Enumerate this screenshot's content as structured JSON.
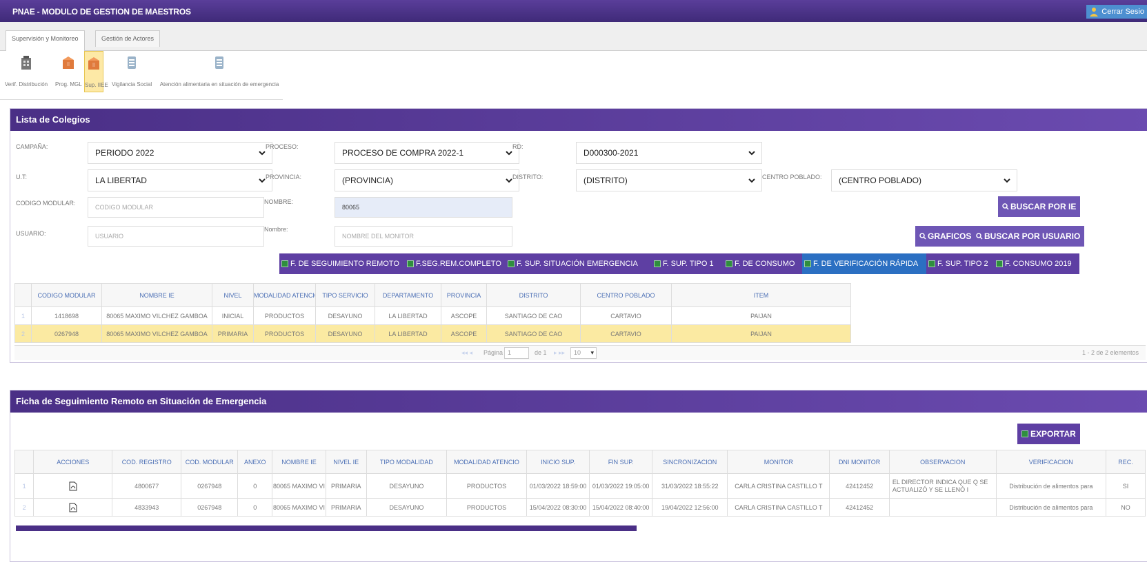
{
  "app": {
    "title": "PNAE - MODULO DE GESTION DE MAESTROS",
    "logout_label": "Cerrar Sesio"
  },
  "tabs": [
    {
      "label": "Supervisión y Monitoreo"
    },
    {
      "label": "Gestión de Actores"
    }
  ],
  "tools": [
    {
      "label": "Verif. Distribución",
      "icon": "building-icon"
    },
    {
      "label": "Prog. MGL",
      "icon": "box-icon"
    },
    {
      "label": "Sup. IIEE",
      "icon": "box-icon"
    },
    {
      "label": "Vigilancia Social",
      "icon": "document-icon"
    },
    {
      "label": "Atención alimentaria en situación de emergencia",
      "icon": "document-icon"
    }
  ],
  "colegios": {
    "title": "Lista de Colegios",
    "labels": {
      "campana": "CAMPAÑA:",
      "proceso": "PROCESO:",
      "rd": "RD:",
      "ut": "U.T:",
      "provincia": "PROVINCIA:",
      "distrito": "DISTRITO:",
      "centro_poblado": "CENTRO POBLADO:",
      "codigo_modular": "CODIGO MODULAR:",
      "nombre": "NOMBRE:",
      "usuario": "USUARIO:",
      "nombre_monitor": "Nombre:"
    },
    "values": {
      "campana": "PERIODO 2022",
      "proceso": "PROCESO DE COMPRA 2022-1",
      "rd": "D000300-2021",
      "ut": "LA LIBERTAD",
      "provincia": "(PROVINCIA)",
      "distrito": "(DISTRITO)",
      "centro_poblado": "(CENTRO POBLADO)",
      "nombre": "80065"
    },
    "placeholders": {
      "codigo_modular": "CODIGO MODULAR",
      "usuario": "USUARIO",
      "nombre_monitor": "NOMBRE DEL MONITOR"
    },
    "buttons": {
      "buscar_ie": "BUSCAR POR IE",
      "graficos": "GRAFICOS",
      "buscar_usuario": "BUSCAR POR USUARIO"
    },
    "form_buttons": [
      "F. DE SEGUIMIENTO REMOTO",
      "F.SEG.REM.COMPLETO",
      "F. SUP. SITUACIÓN EMERGENCIA",
      "F. SUP. TIPO 1",
      "F. DE CONSUMO",
      "F. DE VERIFICACIÓN RÁPIDA",
      "F. SUP. TIPO 2",
      "F. CONSUMO 2019"
    ],
    "columns": [
      "CODIGO MODULAR",
      "NOMBRE IE",
      "NIVEL",
      "MODALIDAD ATENCIO",
      "TIPO SERVICIO",
      "DEPARTAMENTO",
      "PROVINCIA",
      "DISTRITO",
      "CENTRO POBLADO",
      "ITEM"
    ],
    "rows": [
      {
        "n": "1",
        "cells": [
          "1418698",
          "80065 MAXIMO VILCHEZ GAMBOA",
          "INICIAL",
          "PRODUCTOS",
          "DESAYUNO",
          "LA LIBERTAD",
          "ASCOPE",
          "SANTIAGO DE CAO",
          "CARTAVIO",
          "PAIJAN"
        ]
      },
      {
        "n": "2",
        "cells": [
          "0267948",
          "80065 MAXIMO VILCHEZ GAMBOA",
          "PRIMARIA",
          "PRODUCTOS",
          "DESAYUNO",
          "LA LIBERTAD",
          "ASCOPE",
          "SANTIAGO DE CAO",
          "CARTAVIO",
          "PAIJAN"
        ]
      }
    ],
    "pager": {
      "page_label": "Página",
      "page": "1",
      "of_label": "de 1",
      "page_size": "10",
      "summary": "1 - 2 de 2 elementos"
    }
  },
  "ficha": {
    "title": "Ficha de Seguimiento Remoto en Situación de Emergencia",
    "export_label": "EXPORTAR",
    "columns": [
      "ACCIONES",
      "COD. REGISTRO",
      "COD. MODULAR",
      "ANEXO",
      "NOMBRE IE",
      "NIVEL IE",
      "TIPO MODALIDAD",
      "MODALIDAD ATENCIO",
      "INICIO SUP.",
      "FIN SUP.",
      "SINCRONIZACION",
      "MONITOR",
      "DNI MONITOR",
      "OBSERVACION",
      "VERIFICACION",
      "REC."
    ],
    "rows": [
      {
        "n": "1",
        "cells": [
          "",
          "4800677",
          "0267948",
          "0",
          "80065 MAXIMO VI",
          "PRIMARIA",
          "DESAYUNO",
          "PRODUCTOS",
          "01/03/2022 18:59:00",
          "01/03/2022 19:05:00",
          "31/03/2022 18:55:22",
          "CARLA CRISTINA CASTILLO T",
          "42412452",
          "EL DIRECTOR INDICA QUE Q SE ACTUALIZÓ Y SE LLENÓ I",
          "Distribución de alimentos para",
          "SI"
        ]
      },
      {
        "n": "2",
        "cells": [
          "",
          "4833943",
          "0267948",
          "0",
          "80065 MAXIMO VI",
          "PRIMARIA",
          "DESAYUNO",
          "PRODUCTOS",
          "15/04/2022 08:30:00",
          "15/04/2022 08:40:00",
          "19/04/2022 12:56:00",
          "CARLA CRISTINA CASTILLO T",
          "42412452",
          "",
          "Distribución de alimentos para",
          "NO"
        ]
      }
    ]
  }
}
